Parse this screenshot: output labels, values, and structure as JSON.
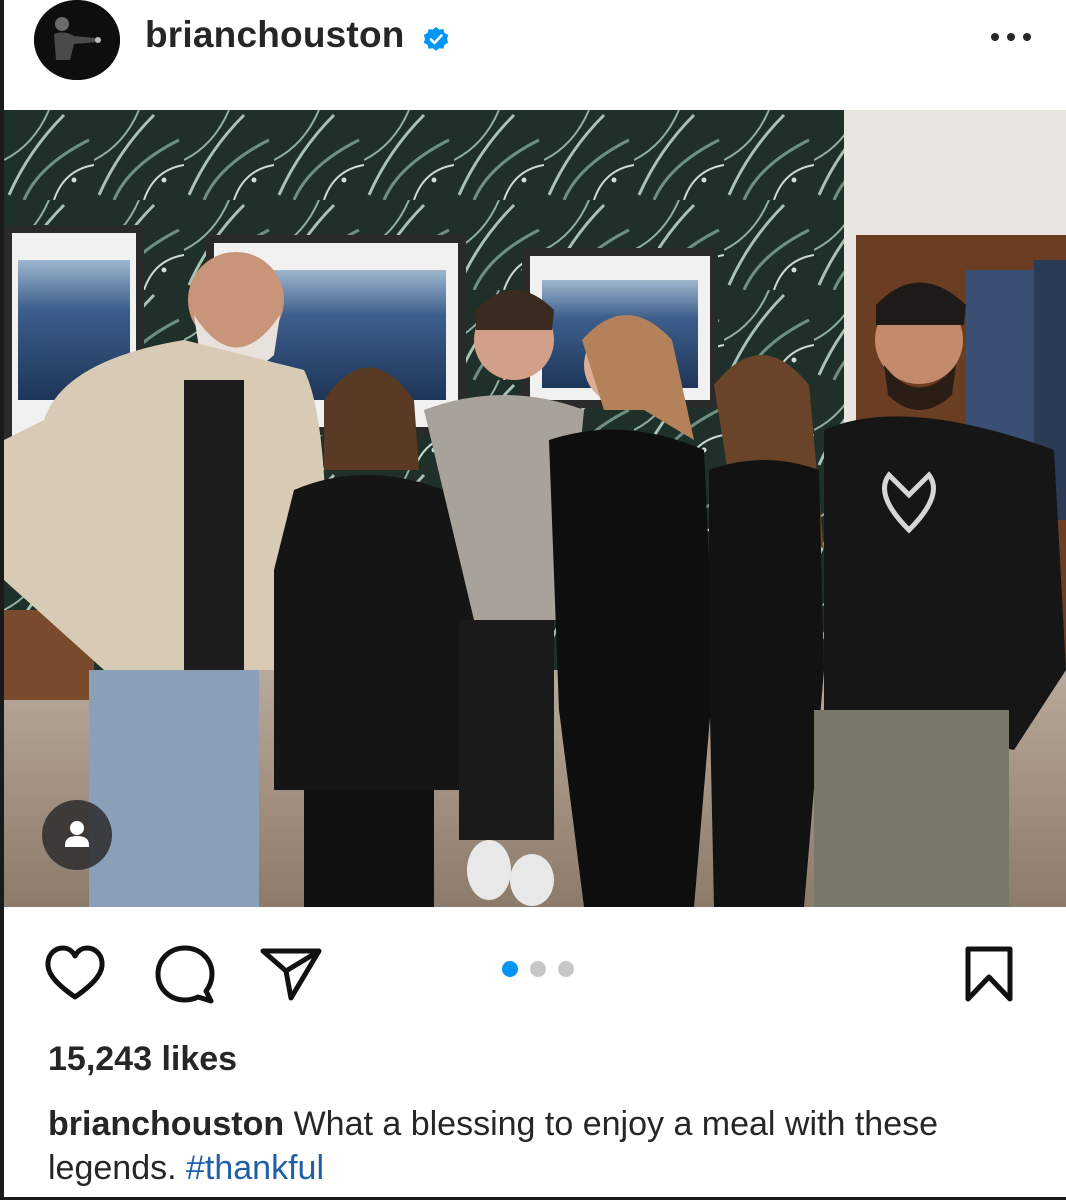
{
  "post": {
    "username": "brianchouston",
    "verified": true,
    "likes_text": "15,243 likes",
    "caption": {
      "username": "brianchouston",
      "text": "What a blessing to enjoy a meal with these legends.",
      "hashtag": "#thankful"
    },
    "carousel": {
      "count": 3,
      "active_index": 0
    }
  },
  "icons": {
    "header": [
      "avatar",
      "verified-badge-icon",
      "more-options-icon"
    ],
    "actions": [
      "heart-icon",
      "comment-icon",
      "share-icon",
      "bookmark-icon"
    ],
    "photo": [
      "user-tag-icon"
    ]
  },
  "colors": {
    "text": "#262626",
    "verified": "#0095f6",
    "hashtag": "#1e5fa8",
    "dot_active": "#0095f6",
    "dot_inactive": "#c7c7c7"
  }
}
